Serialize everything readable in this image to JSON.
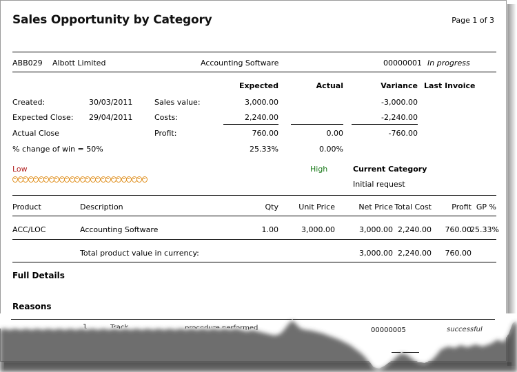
{
  "document": {
    "title": "Sales Opportunity by Category",
    "page_indicator": "Page 1 of 3"
  },
  "opportunity_header": {
    "account_code": "ABB029",
    "account_name": "Albott Limited",
    "description": "Accounting Software",
    "reference": "00000001",
    "status": "In progress"
  },
  "summary": {
    "column_headers": {
      "expected": "Expected",
      "actual": "Actual",
      "variance": "Variance",
      "last_invoice": "Last Invoice"
    },
    "dates": {
      "created_label": "Created:",
      "created_value": "30/03/2011",
      "expected_close_label": "Expected Close:",
      "expected_close_value": "29/04/2011",
      "actual_close_label": "Actual Close",
      "actual_close_value": "",
      "chance_of_win": "% change of win = 50%"
    },
    "rows": [
      {
        "label": "Sales value:",
        "expected": "3,000.00",
        "actual": "",
        "variance": "-3,000.00",
        "last_invoice": ""
      },
      {
        "label": "Costs:",
        "expected": "2,240.00",
        "actual": "",
        "variance": "-2,240.00",
        "last_invoice": ""
      },
      {
        "label": "Profit:",
        "expected": "760.00",
        "actual": "0.00",
        "variance": "-760.00",
        "last_invoice": ""
      },
      {
        "label": "",
        "expected": "25.33%",
        "actual": "0.00%",
        "variance": "",
        "last_invoice": ""
      }
    ]
  },
  "gauge": {
    "low_label": "Low",
    "high_label": "High",
    "filled_count": 26,
    "color": "#E0901E",
    "low_color": "#B22222",
    "high_color": "#1A7A1A"
  },
  "current_category": {
    "heading": "Current Category",
    "value": "Initial request"
  },
  "product_table": {
    "headers": [
      "Product",
      "Description",
      "Qty",
      "Unit Price",
      "Net Price",
      "Total Cost",
      "Profit",
      "GP %"
    ],
    "rows": [
      {
        "product": "ACC/LOC",
        "description": "Accounting Software",
        "qty": "1.00",
        "unit_price": "3,000.00",
        "net_price": "3,000.00",
        "total_cost": "2,240.00",
        "profit": "760.00",
        "gp_percent": "25.33%"
      }
    ],
    "total_row": {
      "label": "Total product value in currency:",
      "net_price": "3,000.00",
      "total_cost": "2,240.00",
      "profit": "760.00"
    }
  },
  "sections": {
    "full_details": "Full Details",
    "reasons": "Reasons"
  },
  "torn_footer": {
    "partial_reference": "00000005",
    "partial_text_left": "procedure",
    "partial_text_right": "essful"
  }
}
